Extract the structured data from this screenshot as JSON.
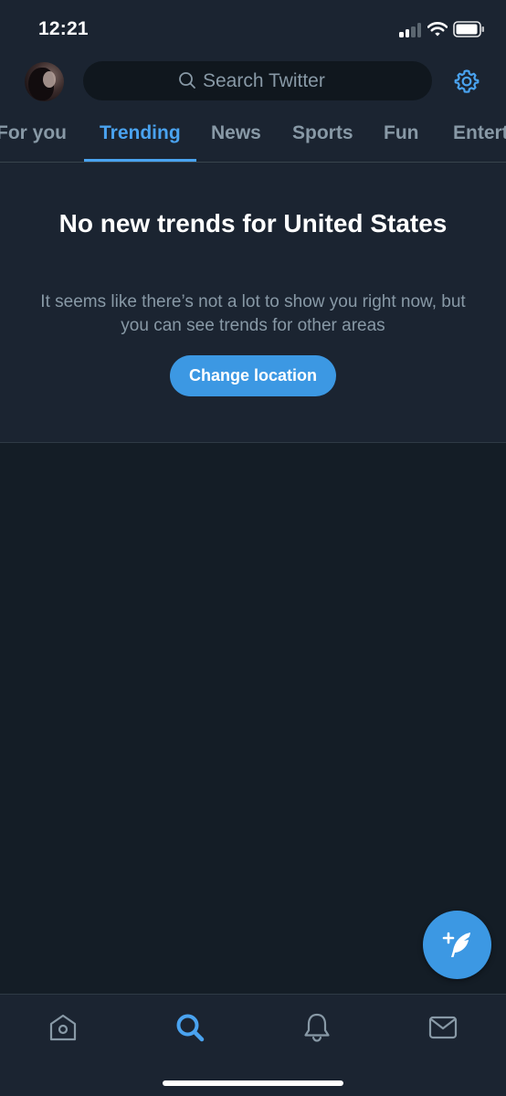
{
  "status_bar": {
    "time": "12:21"
  },
  "header": {
    "search_placeholder": "Search Twitter",
    "icons": {
      "settings": "gear-icon",
      "search": "search-icon"
    }
  },
  "tabs": [
    {
      "label": "For you",
      "active": false
    },
    {
      "label": "Trending",
      "active": true
    },
    {
      "label": "News",
      "active": false
    },
    {
      "label": "Sports",
      "active": false
    },
    {
      "label": "Fun",
      "active": false
    },
    {
      "label": "Entert",
      "active": false
    }
  ],
  "empty_state": {
    "title": "No new trends for United States",
    "description": "It seems like there’s not a lot to show you right now, but you can see trends for other areas",
    "button_label": "Change location"
  },
  "bottom_nav": {
    "items": [
      {
        "icon": "home-icon",
        "active": false
      },
      {
        "icon": "search-icon",
        "active": true
      },
      {
        "icon": "bell-icon",
        "active": false
      },
      {
        "icon": "mail-icon",
        "active": false
      }
    ]
  },
  "colors": {
    "accent": "#4aa3f0",
    "button": "#3c98e3",
    "background_dark": "#141d26",
    "surface": "#1b2431",
    "secondary_text": "#8899a6"
  }
}
